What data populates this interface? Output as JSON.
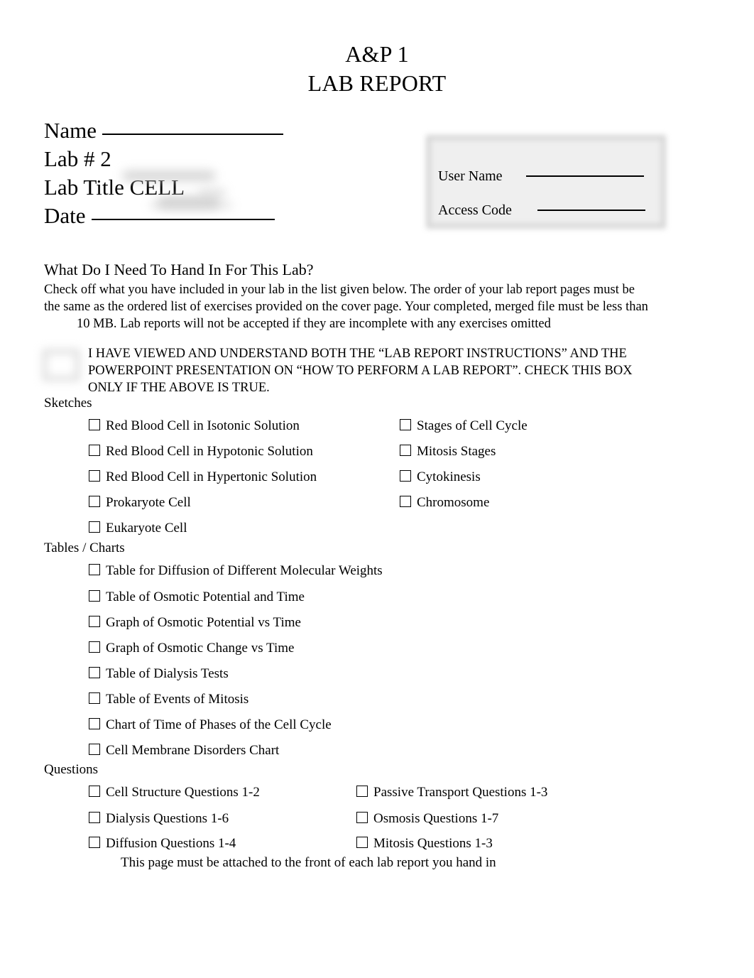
{
  "document": {
    "title_line1": "A&P 1",
    "title_line2": "LAB REPORT"
  },
  "identity": {
    "name_label": "Name",
    "lab_number_label": "Lab # 2",
    "lab_title_label": "Lab Title CELL",
    "date_label": "Date"
  },
  "access_box": {
    "user_name_label": "User Name",
    "access_code_label": "Access Code"
  },
  "handin": {
    "heading": "What Do I Need To Hand In For This Lab?",
    "paragraph_part1": "Check off what you have included in your lab in the list given below. The order of your lab report pages must be the same as the ordered list of exercises provided on the cover page. Your completed, merged file must be less than",
    "size_value": "10",
    "paragraph_part2": "MB. Lab reports will not be accepted if they are incomplete with any exercises omitted",
    "attestation": "I HAVE VIEWED AND UNDERSTAND BOTH THE “LAB REPORT INSTRUCTIONS” AND THE POWERPOINT PRESENTATION ON “HOW TO PERFORM A LAB REPORT”. CHECK THIS BOX ONLY IF THE ABOVE IS TRUE."
  },
  "sections": {
    "sketches_label": "Sketches",
    "tables_label": "Tables / Charts",
    "questions_label": "Questions"
  },
  "sketches": {
    "column1": [
      "Red Blood Cell in Isotonic Solution",
      "Red Blood Cell in Hypotonic Solution",
      "Red Blood Cell in Hypertonic Solution",
      "Prokaryote Cell",
      "Eukaryote Cell"
    ],
    "column2": [
      "Stages of Cell Cycle",
      "Mitosis Stages",
      "Cytokinesis",
      "Chromosome"
    ]
  },
  "tables_charts": [
    "Table for Diffusion of Different Molecular Weights",
    "Table of Osmotic Potential and Time",
    "Graph of Osmotic Potential vs Time",
    "Graph of Osmotic Change vs Time",
    "Table of Dialysis Tests",
    "Table of Events of Mitosis",
    "Chart of Time of Phases of the Cell Cycle",
    "Cell Membrane Disorders Chart"
  ],
  "questions": {
    "column1": [
      "Cell Structure Questions 1-2",
      "Dialysis Questions 1-6",
      "Diffusion Questions 1-4"
    ],
    "column2": [
      "Passive Transport Questions 1-3",
      "Osmosis Questions 1-7",
      "Mitosis Questions 1-3"
    ]
  },
  "footer": {
    "note": "This page must be attached to the front of each lab report you hand in"
  }
}
